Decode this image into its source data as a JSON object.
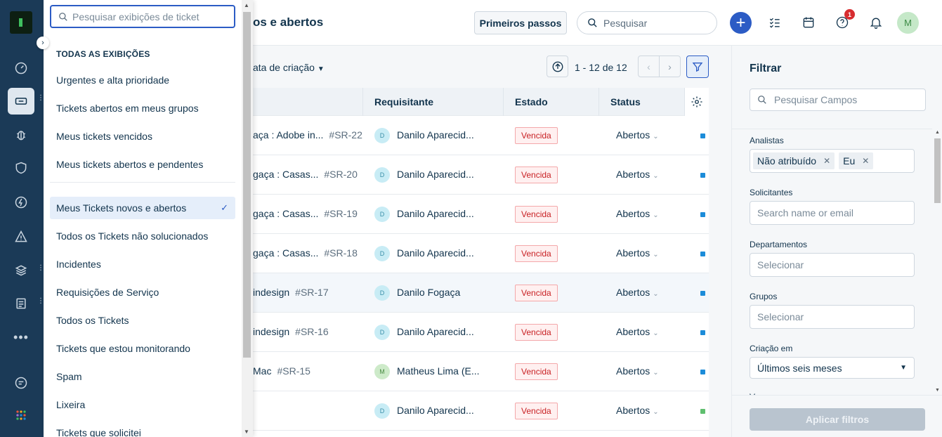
{
  "views_panel": {
    "search_placeholder": "Pesquisar exibições de ticket",
    "heading": "TODAS AS EXIBIÇÕES",
    "items": [
      "Urgentes e alta prioridade",
      "Tickets abertos em meus grupos",
      "Meus tickets vencidos",
      "Meus tickets abertos e pendentes",
      "Meus Tickets novos e abertos",
      "Todos os Tickets não solucionados",
      "Incidentes",
      "Requisições de Serviço",
      "Todos os Tickets",
      "Tickets que estou monitorando",
      "Spam",
      "Lixeira",
      "Tickets que solicitei"
    ],
    "selected_item": "Meus Tickets novos e abertos",
    "check_icon": "✓"
  },
  "header": {
    "title": "os e abertos",
    "getting_started": "Primeiros passos",
    "search_placeholder": "Pesquisar",
    "notification_count": "1",
    "avatar_initial": "M"
  },
  "toolbar": {
    "sort_label": "ata de criação",
    "pagination": "1 - 12 de 12"
  },
  "table": {
    "columns": [
      "Requisitante",
      "Estado",
      "Status"
    ],
    "rows": [
      {
        "subject": "aça : Adobe in...",
        "number": "#SR-22",
        "initial": "D",
        "requester": "Danilo Aparecid...",
        "state": "Vencida",
        "status": "Abertos",
        "priority_color": "#1c8cd9"
      },
      {
        "subject": "gaça : Casas...",
        "number": "#SR-20",
        "initial": "D",
        "requester": "Danilo Aparecid...",
        "state": "Vencida",
        "status": "Abertos",
        "priority_color": "#1c8cd9"
      },
      {
        "subject": "gaça : Casas...",
        "number": "#SR-19",
        "initial": "D",
        "requester": "Danilo Aparecid...",
        "state": "Vencida",
        "status": "Abertos",
        "priority_color": "#1c8cd9"
      },
      {
        "subject": "gaça : Casas...",
        "number": "#SR-18",
        "initial": "D",
        "requester": "Danilo Aparecid...",
        "state": "Vencida",
        "status": "Abertos",
        "priority_color": "#1c8cd9"
      },
      {
        "subject": "indesign",
        "number": "#SR-17",
        "initial": "D",
        "requester": "Danilo Fogaça",
        "state": "Vencida",
        "status": "Abertos",
        "priority_color": "#1c8cd9"
      },
      {
        "subject": "indesign",
        "number": "#SR-16",
        "initial": "D",
        "requester": "Danilo Aparecid...",
        "state": "Vencida",
        "status": "Abertos",
        "priority_color": "#1c8cd9"
      },
      {
        "subject": "Mac",
        "number": "#SR-15",
        "initial": "M",
        "requester": "Matheus Lima (E...",
        "state": "Vencida",
        "status": "Abertos",
        "priority_color": "#1c8cd9"
      },
      {
        "subject": "",
        "number": "",
        "initial": "D",
        "requester": "Danilo Aparecid...",
        "state": "Vencida",
        "status": "Abertos",
        "priority_color": "#5fbf6f"
      }
    ]
  },
  "filter": {
    "title": "Filtrar",
    "search_placeholder": "Pesquisar Campos",
    "analysts_label": "Analistas",
    "analysts_tags": [
      "Não atribuído",
      "Eu"
    ],
    "requesters_label": "Solicitantes",
    "requesters_placeholder": "Search name or email",
    "departments_label": "Departamentos",
    "departments_placeholder": "Selecionar",
    "groups_label": "Grupos",
    "groups_placeholder": "Selecionar",
    "created_label": "Criação em",
    "created_value": "Últimos seis meses",
    "cut_label": "V",
    "apply_label": "Aplicar filtros"
  }
}
